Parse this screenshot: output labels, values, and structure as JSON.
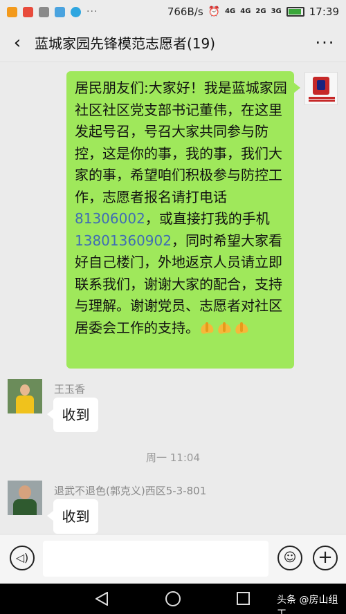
{
  "status_bar": {
    "network_speed": "766B/s",
    "sig1": "4G",
    "sig2": "4G",
    "sig3": "2G",
    "sig4": "3G",
    "time": "17:39",
    "icons": [
      "app-icon-orange",
      "app-icon-red",
      "photo-icon",
      "voicemail-icon",
      "telegram-icon"
    ],
    "dots": "···"
  },
  "header": {
    "title": "蓝城家园先锋模范志愿者(19)",
    "back_icon": "‹",
    "more_icon": "···"
  },
  "messages": {
    "outgoing": {
      "part1": "居民朋友们:大家好！我是蓝城家园社区社区党支部书记董伟，在这里发起号召，号召大家共同参与防控，这是你的事，我的事，我们大家的事，希望咱们积极参与防控工作，志愿者报名请打电话",
      "phone1": "81306002",
      "part2": "，或直接打我的手机",
      "phone2": "13801360902",
      "part3": "，同时希望大家看好自己楼门，外地返京人员请立即联系我们，谢谢大家的配合，支持与理解。谢谢党员、志愿者对社区居委会工作的支持。",
      "emoji": "folded-hands-emoji"
    },
    "msg1": {
      "sender": "王玉香",
      "text": "收到"
    },
    "timestamp": "周一 11:04",
    "msg2": {
      "sender": "退武不退色(郭克义)西区5-3-801",
      "text": "收到"
    }
  },
  "input_bar": {
    "value": "",
    "voice_icon": "◁)",
    "emoji_icon": "☺",
    "plus_icon": "+"
  },
  "watermark": "头条 @房山组工",
  "colors": {
    "bubble_green": "#9fe85b",
    "phone_link": "#3f6cb5",
    "background": "#ebebeb"
  }
}
